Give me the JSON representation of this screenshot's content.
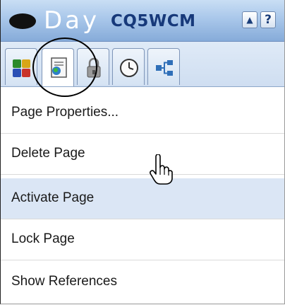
{
  "header": {
    "brand_day": "Day",
    "brand_product": "CQ5WCM",
    "btn_up_glyph": "▲",
    "btn_help_glyph": "?",
    "colors": {
      "header_top": "#c9def4",
      "header_bottom": "#86abd9",
      "brand_text": "#17397a"
    }
  },
  "tabs": [
    {
      "icon": "color-blocks-icon"
    },
    {
      "icon": "page-icon",
      "active": true
    },
    {
      "icon": "lock-icon"
    },
    {
      "icon": "clock-icon"
    },
    {
      "icon": "tree-icon"
    }
  ],
  "menu": {
    "items": [
      {
        "label": "Page Properties..."
      },
      {
        "label": "Delete Page"
      },
      {
        "label": "Activate Page",
        "highlighted": true
      },
      {
        "label": "Lock Page"
      },
      {
        "label": "Show References"
      }
    ],
    "highlight_color": "#dbe6f5"
  },
  "cursor": {
    "icon": "hand-pointer-icon"
  }
}
